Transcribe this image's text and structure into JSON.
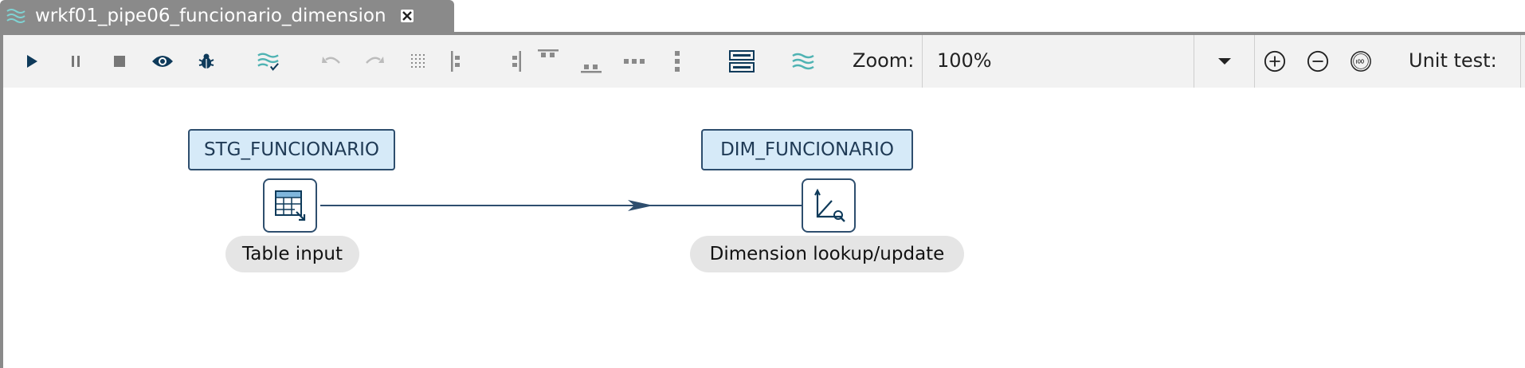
{
  "tab": {
    "title": "wrkf01_pipe06_funcionario_dimension",
    "icon": "pipeline-icon",
    "close_icon": "close-icon"
  },
  "toolbar": {
    "buttons": [
      "run",
      "pause",
      "stop",
      "preview",
      "debug",
      "check",
      "undo",
      "redo",
      "align-grid",
      "align-left",
      "align-right",
      "align-top",
      "align-bottom",
      "distribute-horizontal",
      "distribute-vertical",
      "show-steps",
      "impact"
    ],
    "zoom_label": "Zoom:",
    "zoom_value": "100%",
    "unit_test_label": "Unit test:"
  },
  "canvas": {
    "steps": [
      {
        "name": "STG_FUNCIONARIO",
        "type": "Table input",
        "icon": "table-input-icon"
      },
      {
        "name": "DIM_FUNCIONARIO",
        "type": "Dimension lookup/update",
        "icon": "dimension-lookup-icon"
      }
    ],
    "hop": {
      "from": "STG_FUNCIONARIO",
      "to": "DIM_FUNCIONARIO"
    }
  },
  "colors": {
    "tab_bg": "#8a8a8a",
    "step_fill": "#d6eaf8",
    "step_border": "#2e4e6e",
    "hop_color": "#2e4e6e",
    "icon_teal": "#4fb3b3"
  }
}
